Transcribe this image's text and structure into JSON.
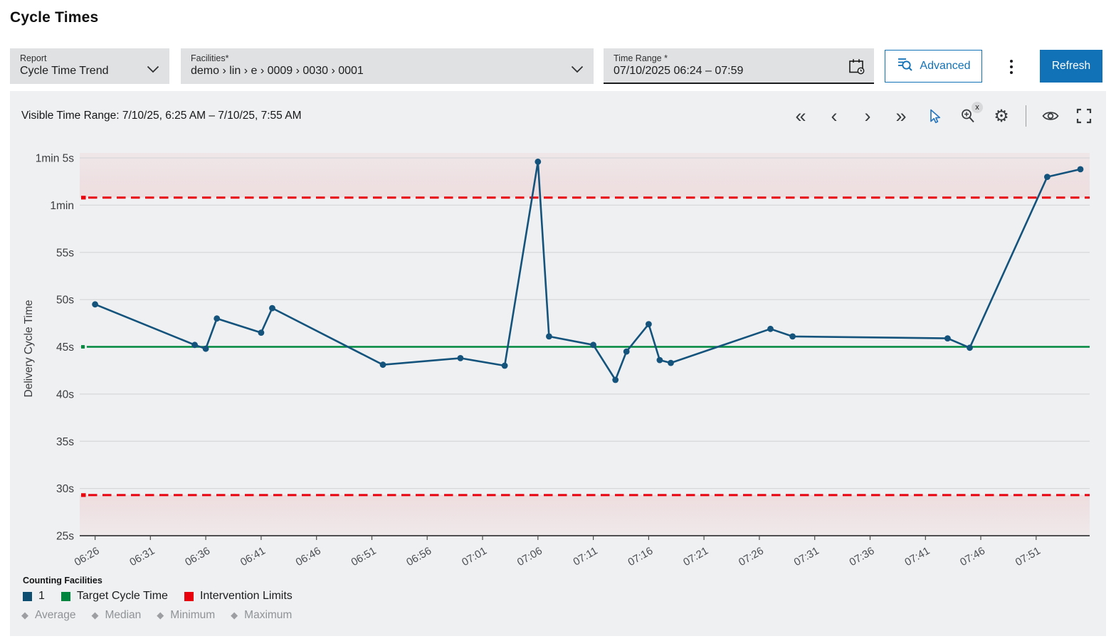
{
  "page": {
    "title": "Cycle Times"
  },
  "controls": {
    "report": {
      "label": "Report",
      "value": "Cycle Time Trend"
    },
    "facilities": {
      "label": "Facilities*",
      "value": "demo › lin › e › 0009 › 0030 › 0001"
    },
    "time_range": {
      "label": "Time Range *",
      "value": "07/10/2025 06:24 – 07:59"
    },
    "advanced_label": "Advanced",
    "refresh_label": "Refresh"
  },
  "chart_header": {
    "visible_time_range": "Visible Time Range: 7/10/25, 6:25 AM – 7/10/25, 7:55 AM"
  },
  "toolbar": {
    "skip_previous_glyph": "«",
    "step_previous_glyph": "‹",
    "step_next_glyph": "›",
    "skip_next_glyph": "»",
    "zoom_badge": "x",
    "gear_glyph": "⚙"
  },
  "chart_data": {
    "type": "line",
    "title": "",
    "xlabel": "",
    "ylabel": "Delivery Cycle Time",
    "grid": true,
    "x_range": [
      "06:25",
      "07:55"
    ],
    "y_range_sec": [
      25,
      65
    ],
    "y_ticks": [
      {
        "sec": 65,
        "label": "1min 5s"
      },
      {
        "sec": 60,
        "label": "1min"
      },
      {
        "sec": 55,
        "label": "55s"
      },
      {
        "sec": 50,
        "label": "50s"
      },
      {
        "sec": 45,
        "label": "45s"
      },
      {
        "sec": 40,
        "label": "40s"
      },
      {
        "sec": 35,
        "label": "35s"
      },
      {
        "sec": 30,
        "label": "30s"
      },
      {
        "sec": 25,
        "label": "25s"
      }
    ],
    "x_ticks": [
      "06:26",
      "06:31",
      "06:36",
      "06:41",
      "06:46",
      "06:51",
      "06:56",
      "07:01",
      "07:06",
      "07:11",
      "07:16",
      "07:21",
      "07:26",
      "07:31",
      "07:36",
      "07:41",
      "07:46",
      "07:51"
    ],
    "series": [
      {
        "name": "1",
        "color": "#14537c",
        "points": [
          [
            "06:26",
            49.5
          ],
          [
            "06:35",
            45.2
          ],
          [
            "06:36",
            44.8
          ],
          [
            "06:37",
            48.0
          ],
          [
            "06:41",
            46.5
          ],
          [
            "06:42",
            49.1
          ],
          [
            "06:52",
            43.1
          ],
          [
            "06:59",
            43.8
          ],
          [
            "07:03",
            43.0
          ],
          [
            "07:06",
            64.6
          ],
          [
            "07:07",
            46.1
          ],
          [
            "07:11",
            45.2
          ],
          [
            "07:13",
            41.5
          ],
          [
            "07:14",
            44.5
          ],
          [
            "07:16",
            47.4
          ],
          [
            "07:17",
            43.6
          ],
          [
            "07:18",
            43.3
          ],
          [
            "07:27",
            46.9
          ],
          [
            "07:29",
            46.1
          ],
          [
            "07:43",
            45.9
          ],
          [
            "07:45",
            44.9
          ],
          [
            "07:52",
            63.0
          ],
          [
            "07:55",
            63.8
          ]
        ]
      }
    ],
    "target_cycle_time": {
      "sec": 45,
      "color": "#00883f"
    },
    "intervention_limits": {
      "upper_sec": 60.8,
      "lower_sec": 29.3,
      "color": "#e8000d",
      "band_color": "#e8000d"
    }
  },
  "legend": {
    "title": "Counting Facilities",
    "items": [
      {
        "label": "1",
        "color": "#0e4e70"
      },
      {
        "label": "Target Cycle Time",
        "color": "#00853e"
      },
      {
        "label": "Intervention Limits",
        "color": "#e8000d"
      }
    ],
    "stat_items": [
      {
        "label": "Average"
      },
      {
        "label": "Median"
      },
      {
        "label": "Minimum"
      },
      {
        "label": "Maximum"
      }
    ],
    "diamond_glyph": "◆"
  },
  "colors": {
    "accent_blue": "#1272b8",
    "panel_bg": "#eff0f1",
    "gridline": "#d7d8da",
    "axis_text": "#4a4d52",
    "control_bg": "#e0e1e2"
  }
}
